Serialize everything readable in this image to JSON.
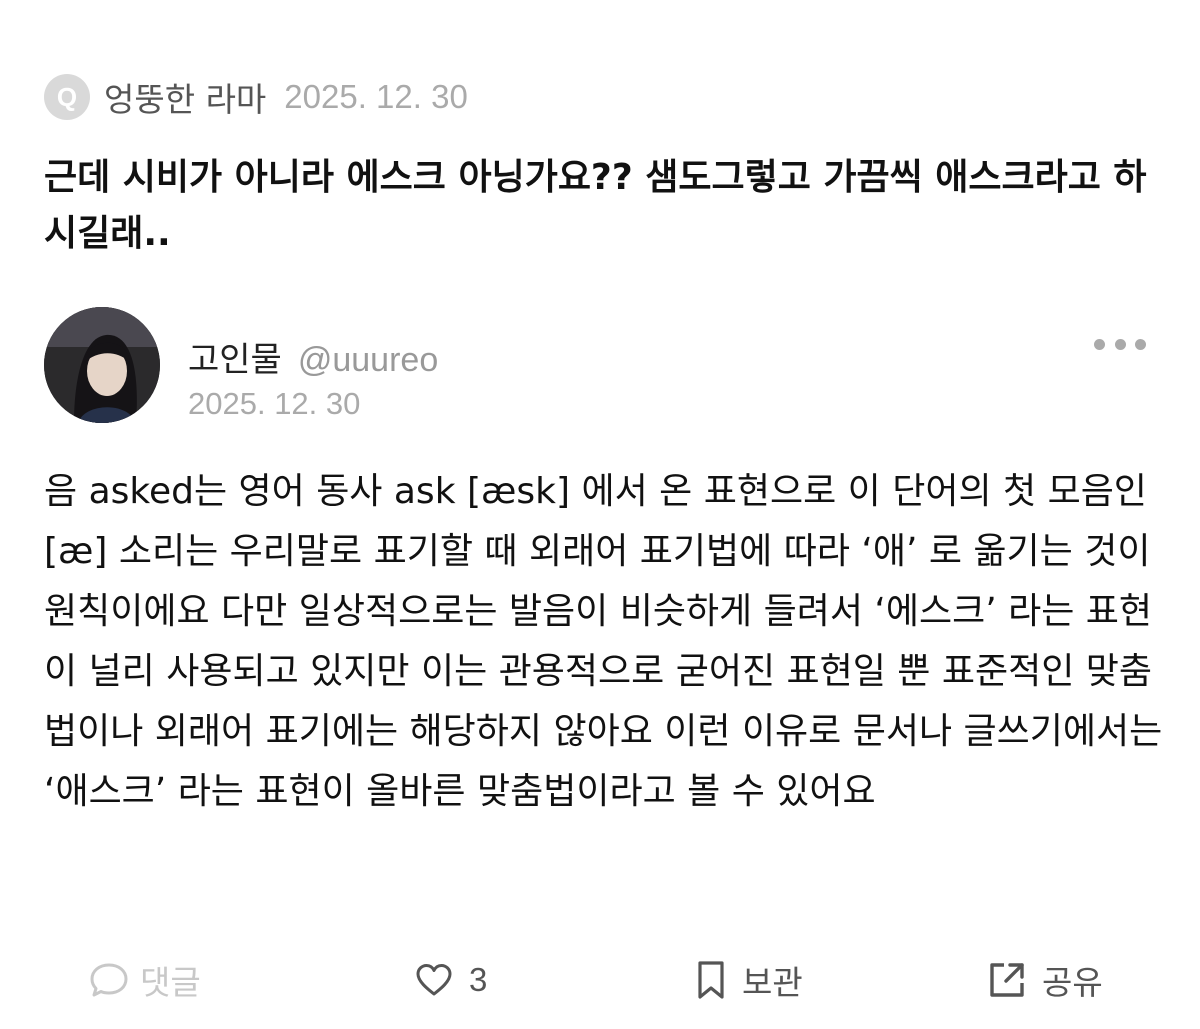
{
  "question": {
    "badge": "Q",
    "author": "엉뚱한 라마",
    "date": "2025. 12. 30",
    "text": "근데 시비가 아니라 에스크 아닝가요?? 샘도그렇고 가끔씩 애스크라고 하시길래.."
  },
  "answer": {
    "name": "고인물",
    "handle": "@uuureo",
    "date": "2025. 12. 30",
    "text": "음 asked는 영어 동사 ask [æsk] 에서 온 표현으로 이 단어의 첫 모음인 [æ] 소리는 우리말로 표기할 때 외래어 표기법에 따라 ‘애’ 로 옮기는 것이 원칙이에요 다만 일상적으로는 발음이 비슷하게 들려서 ‘에스크’ 라는 표현이 널리 사용되고 있지만 이는 관용적으로 굳어진 표현일 뿐 표준적인 맞춤법이나 외래어 표기에는 해당하지 않아요 이런 이유로 문서나 글쓰기에서는 ‘애스크’ 라는 표현이 올바른 맞춤법이라고 볼 수 있어요"
  },
  "actions": {
    "comment_label": "댓글",
    "like_count": "3",
    "save_label": "보관",
    "share_label": "공유"
  },
  "icons": {
    "comment": "speech-bubble-icon",
    "like": "heart-icon",
    "save": "bookmark-icon",
    "share": "share-icon",
    "more": "more-dots-icon"
  },
  "colors": {
    "text": "#111111",
    "muted": "#aaaaaa",
    "disabled": "#c8c8c8",
    "badge_bg": "#d9d9d9"
  }
}
